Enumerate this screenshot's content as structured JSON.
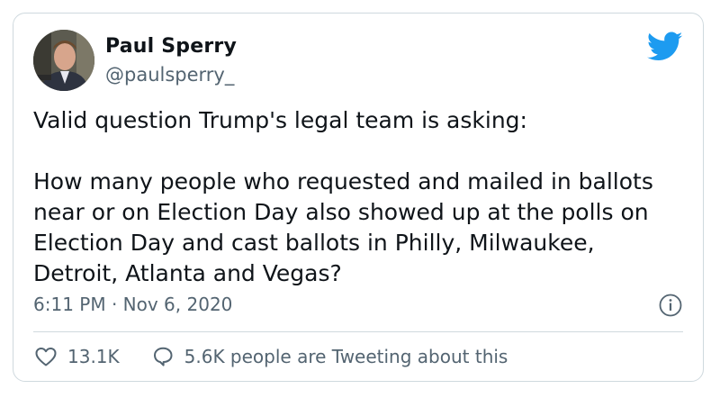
{
  "author": {
    "name": "Paul Sperry",
    "handle": "@paulsperry_"
  },
  "tweet": {
    "text": "Valid question Trump's legal team is asking:\n\nHow many people who requested and mailed in ballots near or on Election Day also showed up at the polls on Election Day and cast ballots in Philly, Milwaukee, Detroit, Atlanta and Vegas?",
    "timestamp": "6:11 PM · Nov 6, 2020"
  },
  "actions": {
    "likes": "13.1K",
    "conversation": "5.6K people are Tweeting about this"
  },
  "icons": {
    "brand": "twitter-bird-icon",
    "info": "info-icon",
    "like": "heart-icon",
    "reply": "speech-bubble-icon"
  },
  "colors": {
    "twitter_blue": "#1d9bf0",
    "secondary_text": "#536471",
    "border": "#cfd9de"
  }
}
